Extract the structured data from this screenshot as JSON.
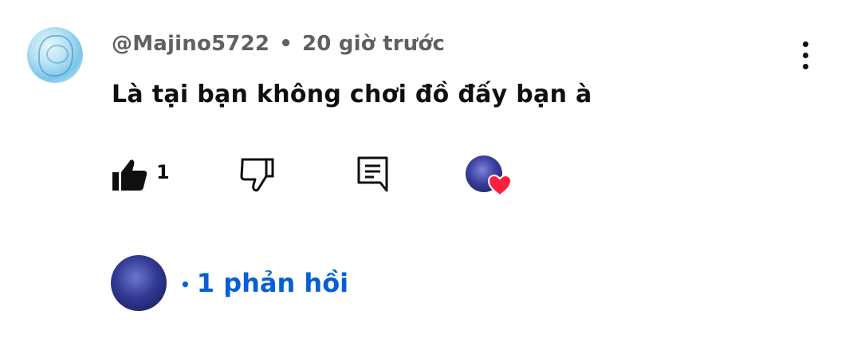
{
  "comment": {
    "author": "@Majino5722",
    "separator": "•",
    "time": "20 giờ trước",
    "text": "Là tại bạn không chơi đồ đấy bạn à",
    "like_count": "1"
  },
  "actions": {
    "like_icon": "thumbs-up-filled-icon",
    "dislike_icon": "thumbs-down-outline-icon",
    "reply_icon": "comment-reply-icon",
    "more_icon": "more-vertical-icon",
    "creator_heart_icon": "heart-icon"
  },
  "replies": {
    "bullet": "•",
    "label": "1 phản hồi"
  },
  "colors": {
    "link": "#065fd4",
    "meta": "#606060",
    "heart": "#ff1f3d"
  }
}
